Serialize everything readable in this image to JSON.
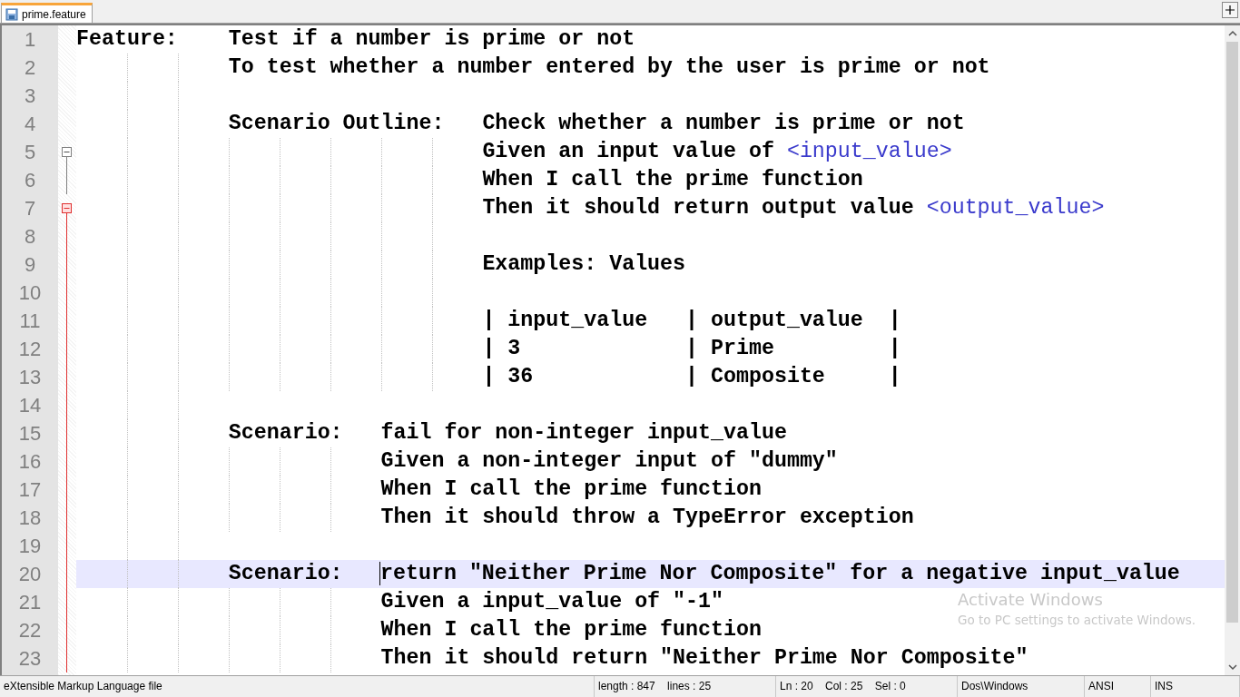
{
  "tabs": [
    {
      "label": "prime.feature",
      "selected": true
    }
  ],
  "editor": {
    "lines": [
      {
        "number": "1",
        "current": false,
        "segments": [
          {
            "text": "Feature:\tTest if a number is prime or not",
            "kind": "plain",
            "caret": false
          }
        ]
      },
      {
        "number": "2",
        "current": false,
        "segments": [
          {
            "text": "\t\t\tTo test whether a number entered by the user is prime or not",
            "kind": "plain",
            "caret": false
          }
        ]
      },
      {
        "number": "3",
        "current": false
      },
      {
        "number": "4",
        "current": false,
        "segments": [
          {
            "text": "\t\t\tScenario Outline:\tCheck whether a number is prime or not",
            "kind": "plain",
            "caret": false
          }
        ]
      },
      {
        "number": "5",
        "current": false,
        "fold": {
          "expanded": true,
          "current": false
        },
        "segments": [
          {
            "text": "\t\t\t\t\t\t\t\tGiven an input value of ",
            "kind": "plain",
            "caret": false
          },
          {
            "text": "<input_value>",
            "kind": "variable",
            "caret": false
          }
        ]
      },
      {
        "number": "6",
        "current": false,
        "segments": [
          {
            "text": "\t\t\t\t\t\t\t\tWhen I call the prime function",
            "kind": "plain",
            "caret": false
          }
        ]
      },
      {
        "number": "7",
        "current": false,
        "fold": {
          "expanded": true,
          "current": true
        },
        "segments": [
          {
            "text": "\t\t\t\t\t\t\t\tThen it should return output value ",
            "kind": "plain",
            "caret": false
          },
          {
            "text": "<output_value>",
            "kind": "variable",
            "caret": false
          }
        ]
      },
      {
        "number": "8",
        "current": false
      },
      {
        "number": "9",
        "current": false,
        "segments": [
          {
            "text": "\t\t\t\t\t\t\t\tExamples: Values",
            "kind": "plain",
            "caret": false
          }
        ]
      },
      {
        "number": "10",
        "current": false
      },
      {
        "number": "11",
        "current": false,
        "segments": [
          {
            "text": "\t\t\t\t\t\t\t\t| input_value   | output_value  |",
            "kind": "plain",
            "caret": false
          }
        ]
      },
      {
        "number": "12",
        "current": false,
        "segments": [
          {
            "text": "\t\t\t\t\t\t\t\t| 3             | Prime         |",
            "kind": "plain",
            "caret": false
          }
        ]
      },
      {
        "number": "13",
        "current": false,
        "segments": [
          {
            "text": "\t\t\t\t\t\t\t\t| 36            | Composite     |",
            "kind": "plain",
            "caret": false
          }
        ]
      },
      {
        "number": "14",
        "current": false
      },
      {
        "number": "15",
        "current": false,
        "segments": [
          {
            "text": "\t\t\tScenario:\tfail for non-integer input_value",
            "kind": "plain",
            "caret": false
          }
        ]
      },
      {
        "number": "16",
        "current": false,
        "segments": [
          {
            "text": "\t\t\t\t\t\tGiven a non-integer input of \"dummy\"",
            "kind": "plain",
            "caret": false
          }
        ]
      },
      {
        "number": "17",
        "current": false,
        "segments": [
          {
            "text": "\t\t\t\t\t\tWhen I call the prime function",
            "kind": "plain",
            "caret": false
          }
        ]
      },
      {
        "number": "18",
        "current": false,
        "segments": [
          {
            "text": "\t\t\t\t\t\tThen it should throw a TypeError exception",
            "kind": "plain",
            "caret": false
          }
        ]
      },
      {
        "number": "19",
        "current": false
      },
      {
        "number": "20",
        "current": true,
        "segments": [
          {
            "text": "\t\t\tScenario:\t",
            "kind": "plain",
            "caret": false
          },
          {
            "text": "return \"Neither Prime Nor Composite\" for a negative input_value",
            "kind": "plain",
            "caret": true
          }
        ]
      },
      {
        "number": "21",
        "current": false,
        "segments": [
          {
            "text": "\t\t\t\t\t\tGiven a input_value of \"-1\"",
            "kind": "plain",
            "caret": false
          }
        ]
      },
      {
        "number": "22",
        "current": false,
        "segments": [
          {
            "text": "\t\t\t\t\t\tWhen I call the prime function",
            "kind": "plain",
            "caret": false
          }
        ]
      },
      {
        "number": "23",
        "current": false,
        "segments": [
          {
            "text": "\t\t\t\t\t\tThen it should return \"Neither Prime Nor Composite\"",
            "kind": "plain",
            "caret": false
          }
        ]
      }
    ]
  },
  "activation_notice": {
    "title": "Activate Windows",
    "subtitle": "Go to PC settings to activate Windows."
  },
  "status_bar": [
    "eXtensible Markup Language file",
    "length : 847    lines : 25",
    "Ln : 20    Col : 25    Sel : 0",
    "Dos\\Windows",
    "ANSI",
    "INS"
  ]
}
